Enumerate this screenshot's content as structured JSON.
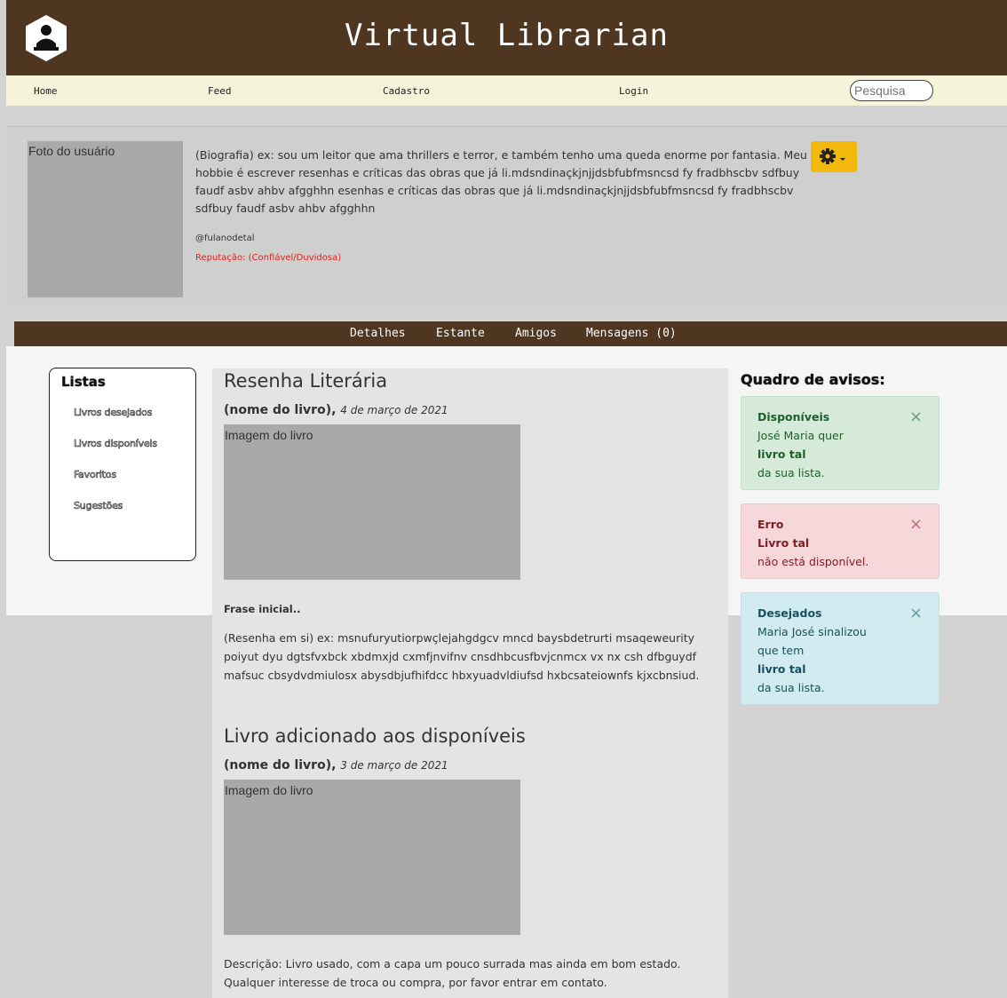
{
  "header": {
    "title": "Virtual Librarian",
    "logo_icon": "reader-icon"
  },
  "nav": {
    "home": "Home",
    "feed": "Feed",
    "cadastro": "Cadastro",
    "login": "Login",
    "search_placeholder": "Pesquisa"
  },
  "profile": {
    "photo_label": "Foto do usuário",
    "bio": "(Biografia) ex: sou um leitor que ama thrillers e terror, e também tenho uma queda enorme por fantasia. Meu hobbie é escrever resenhas e críticas das obras que já li.mdsndinaçkjnjjdsbfubfmsncsd fy fradbhscbv sdfbuy faudf asbv ahbv afgghhn esenhas e críticas das obras que já li.mdsndinaçkjnjjdsbfubfmsncsd fy fradbhscbv sdfbuy faudf asbv ahbv afgghhn",
    "handle": "@fulanodetal",
    "reputation": "Reputação: (Confiável/Duvidosa)",
    "settings_icon": "gear-icon",
    "accent": "#f2b90c"
  },
  "tabs": {
    "detalhes": "Detalhes",
    "estante": "Estante",
    "amigos": "Amigos",
    "mensagens": "Mensagens (0)"
  },
  "lists": {
    "title": "Listas",
    "items": [
      "Livros desejados",
      "Livros disponíveis",
      "Favoritos",
      "Sugestões"
    ]
  },
  "posts": [
    {
      "title": "Resenha Literária",
      "book": "(nome do livro),",
      "date": "4 de março de 2021",
      "image_label": "Imagem do livro",
      "first_line": "Frase inicial..",
      "body": "(Resenha em si) ex: msnufuryutiorpwçlejahgdgcv mncd baysbdetrurti msaqeweurity poiyut dyu dgtsfvxbck xbdmxjd cxmfjnvifnv cnsdhbcusfbvjcnmcx vx nx csh dfbguydf mafsuc cbsydvdmiulosx abysdbjufhifdcc hbxyuadvldiufsd hxbcsateiownfs kjxcbnsiud."
    },
    {
      "title": "Livro adicionado aos disponíveis",
      "book": "(nome do livro),",
      "date": "3 de março de 2021",
      "image_label": "Imagem do livro",
      "body": "Descrição: Livro usado, com a capa um pouco surrada mas ainda em bom estado. Qualquer interesse de troca ou compra, por favor entrar em contato."
    }
  ],
  "notices": {
    "title": "Quadro de avisos:",
    "alerts": [
      {
        "title": "Disponíveis",
        "line1": "José Maria quer",
        "book": "livro tal",
        "line2": "da sua lista.",
        "close": "×",
        "color": "#d5ead8"
      },
      {
        "title": "Erro",
        "book": "Livro tal",
        "line2": "não está disponível.",
        "close": "×",
        "color": "#f6d7da"
      },
      {
        "title": "Desejados",
        "line1": "Maria José sinalizou",
        "line1b": "que tem",
        "book": "livro tal",
        "line2": "da sua lista.",
        "close": "×",
        "color": "#d2ebf1"
      }
    ]
  }
}
